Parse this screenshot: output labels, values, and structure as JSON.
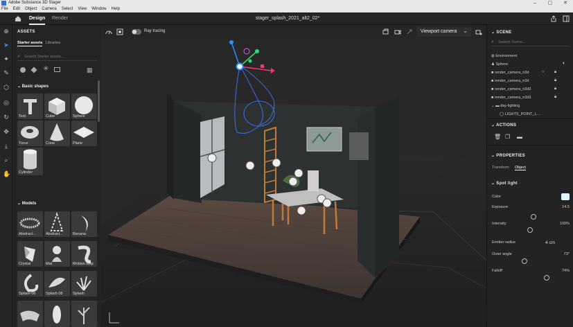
{
  "titlebar": {
    "title": "Adobe Substance 3D Stager",
    "min": "–",
    "max": "▢",
    "close": "✕"
  },
  "menu": [
    "File",
    "Edit",
    "Object",
    "Camera",
    "Select",
    "View",
    "Window",
    "Help"
  ],
  "appbar": {
    "tab_design": "Design",
    "tab_render": "Render",
    "doc_title": "stager_splash_2021_alt2_02*"
  },
  "assets": {
    "title": "ASSETS",
    "tab_starter": "Starter assets",
    "tab_libraries": "Libraries",
    "search_placeholder": "Search Starter assets...",
    "basic_shapes_title": "Basic shapes",
    "models_title": "Models",
    "basic_shapes": [
      "Text",
      "Cube",
      "Sphere",
      "Torus",
      "Cone",
      "Plane",
      "Cylinder"
    ],
    "models": [
      "Abstract...",
      "Abstract...",
      "Banana",
      "Crystal",
      "Mat",
      "Mobius strip",
      "Splash 06",
      "Splash 08",
      "Splash"
    ]
  },
  "viewport": {
    "ray_tracing": "Ray tracing",
    "camera_select": "Viewport camera"
  },
  "scene": {
    "title": "SCENE",
    "search_placeholder": "Search Scene...",
    "items": [
      "Environment",
      "Sphere",
      "render_camera_n3d",
      "render_camera_n3d",
      "render_camera_n3d2",
      "render_camera_n3d3",
      "day-lighting",
      "LIGHTS_POINT_L..."
    ]
  },
  "actions": {
    "title": "ACTIONS"
  },
  "properties": {
    "title": "PROPERTIES",
    "tab_transform": "Transform",
    "tab_object": "Object",
    "section": "Spot light",
    "color_label": "Color",
    "color_value": "#dff4ff",
    "rows": [
      {
        "label": "Exposure",
        "value": "14.5",
        "fraction": 0.55
      },
      {
        "label": "Intensity",
        "value": "100%",
        "fraction": 0.5
      },
      {
        "label": "Emitter radius",
        "value": "4 cm"
      },
      {
        "label": "Outer angle",
        "value": "73°",
        "fraction": 0.42
      },
      {
        "label": "Falloff",
        "value": "74%",
        "fraction": 0.74
      }
    ]
  }
}
